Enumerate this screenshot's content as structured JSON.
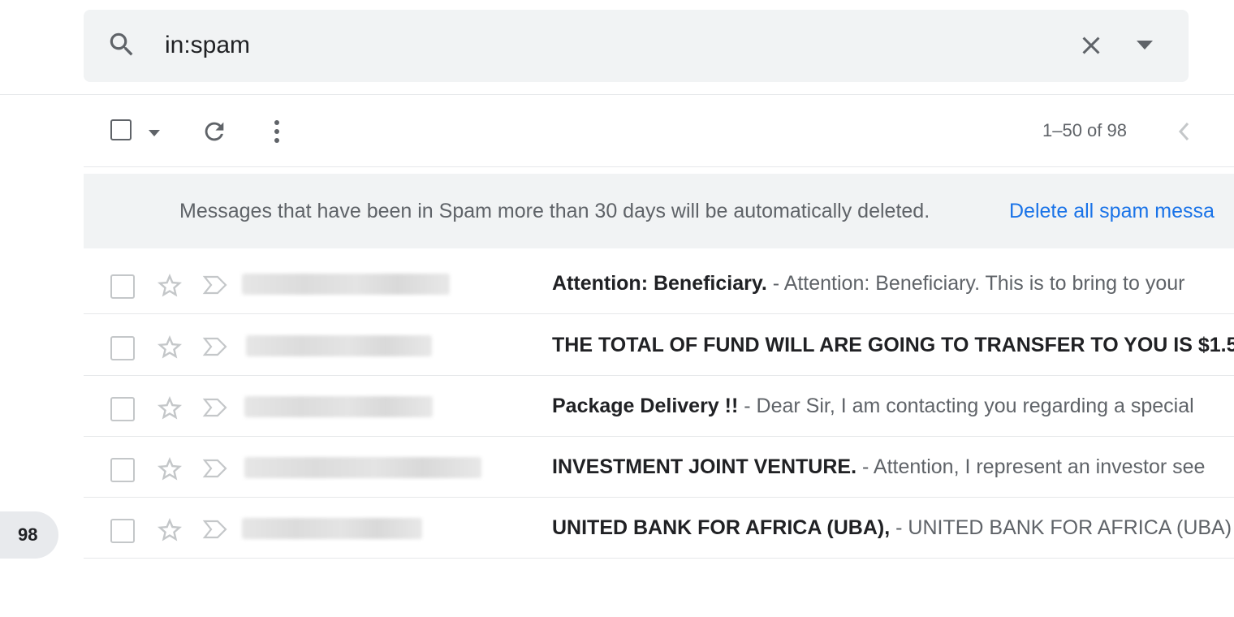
{
  "search": {
    "query": "in:spam"
  },
  "toolbar": {
    "pagination": "1–50 of 98"
  },
  "banner": {
    "text": "Messages that have been in Spam more than 30 days will be automatically deleted.",
    "link": "Delete all spam messa"
  },
  "emails": [
    {
      "subject": "Attention: Beneficiary.",
      "separator": " - ",
      "snippet": "Attention: Beneficiary. This is to bring to your"
    },
    {
      "subject": "THE TOTAL OF FUND WILL ARE GOING TO TRANSFER TO YOU IS $1.5",
      "separator": "",
      "snippet": ""
    },
    {
      "subject": "Package Delivery !!",
      "separator": " - ",
      "snippet": "Dear Sir, I am contacting you regarding a special"
    },
    {
      "subject": "INVESTMENT JOINT VENTURE.",
      "separator": " - ",
      "snippet": "Attention, I represent an investor see"
    },
    {
      "subject": "UNITED BANK FOR AFRICA (UBA),",
      "separator": " - ",
      "snippet": "UNITED BANK FOR AFRICA (UBA)"
    }
  ],
  "sidebar": {
    "spam_count": "98"
  },
  "icons": {
    "search": "search-icon",
    "clear": "close-icon",
    "search_options": "caret-down-icon",
    "select_menu": "caret-down-icon",
    "refresh": "refresh-icon",
    "more": "more-vert-icon",
    "prev_page": "chevron-left-icon",
    "star": "star-outline-icon",
    "importance": "importance-marker-icon"
  },
  "colors": {
    "link": "#1a73e8",
    "muted_text": "#5f6368",
    "surface": "#f1f3f4"
  }
}
